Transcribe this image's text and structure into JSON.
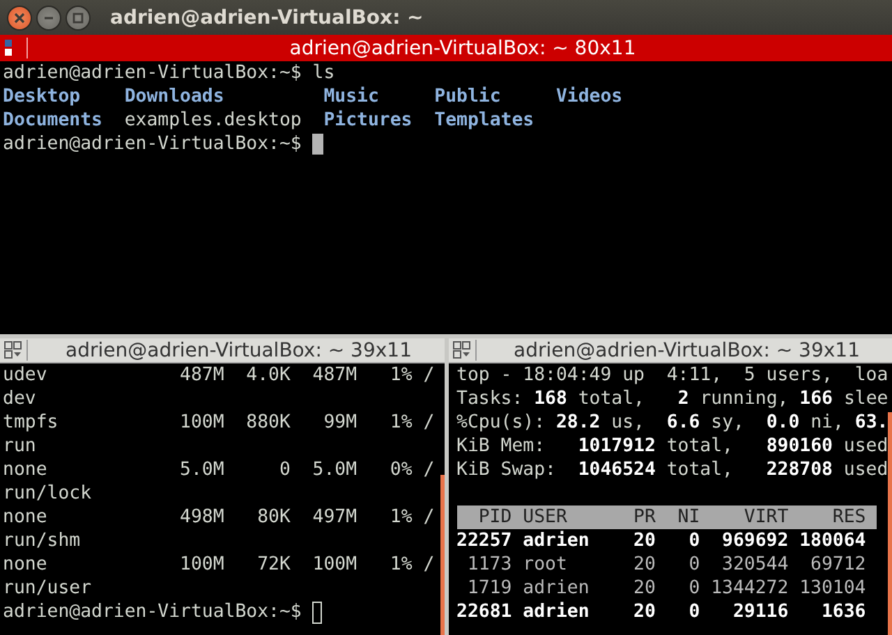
{
  "window": {
    "title": "adrien@adrien-VirtualBox: ~"
  },
  "top_pane": {
    "title": "adrien@adrien-VirtualBox: ~ 80x11",
    "focused": true,
    "lines": [
      {
        "kind": "prompt",
        "text": "adrien@adrien-VirtualBox:~$ ls"
      },
      {
        "kind": "listing",
        "entries": [
          {
            "name": "Desktop",
            "kind": "directory"
          },
          {
            "name": "Downloads",
            "kind": "directory"
          },
          {
            "name": "Music",
            "kind": "directory"
          },
          {
            "name": "Public",
            "kind": "directory"
          },
          {
            "name": "Videos",
            "kind": "directory"
          }
        ]
      },
      {
        "kind": "listing",
        "entries": [
          {
            "name": "Documents",
            "kind": "directory"
          },
          {
            "name": "examples.desktop",
            "kind": "file"
          },
          {
            "name": "Pictures",
            "kind": "directory"
          },
          {
            "name": "Templates",
            "kind": "directory"
          }
        ]
      },
      {
        "kind": "prompt",
        "text": "adrien@adrien-VirtualBox:~$ ",
        "cursor": true
      }
    ]
  },
  "left_pane": {
    "title": "adrien@adrien-VirtualBox: ~ 39x11",
    "focused": false,
    "lines": [
      "udev            487M  4.0K  487M   1% /",
      "dev",
      "tmpfs           100M  880K   99M   1% /",
      "run",
      "none            5.0M     0  5.0M   0% /",
      "run/lock",
      "none            498M   80K  497M   1% /",
      "run/shm",
      "none            100M   72K  100M   1% /",
      "run/user"
    ],
    "prompt": {
      "text": "adrien@adrien-VirtualBox:~$ ",
      "cursor": true
    }
  },
  "right_pane": {
    "title": "adrien@adrien-VirtualBox: ~ 39x11",
    "focused": false,
    "summary": [
      "top - 18:04:49 up  4:11,  5 users,  loa",
      "Tasks: **168** total,   **2** running, **166** slee",
      "%Cpu(s): **28.2** us,  **6.6** sy,  **0.0** ni, **63.**",
      "KiB Mem:   **1017912** total,   **890160** used",
      "KiB Swap:  **1046524** total,   **228708** used"
    ],
    "table": {
      "columns": [
        "PID",
        "USER",
        "PR",
        "NI",
        "VIRT",
        "RES"
      ],
      "rows": [
        {
          "cells": [
            "22257",
            "adrien",
            "20",
            "0",
            "969692",
            "180064"
          ],
          "highlighted": true
        },
        {
          "cells": [
            "1173",
            "root",
            "20",
            "0",
            "320544",
            "69712"
          ],
          "highlighted": false
        },
        {
          "cells": [
            "1719",
            "adrien",
            "20",
            "0",
            "1344272",
            "130104"
          ],
          "highlighted": false
        },
        {
          "cells": [
            "22681",
            "adrien",
            "20",
            "0",
            "29116",
            "1636"
          ],
          "highlighted": true
        }
      ]
    }
  }
}
